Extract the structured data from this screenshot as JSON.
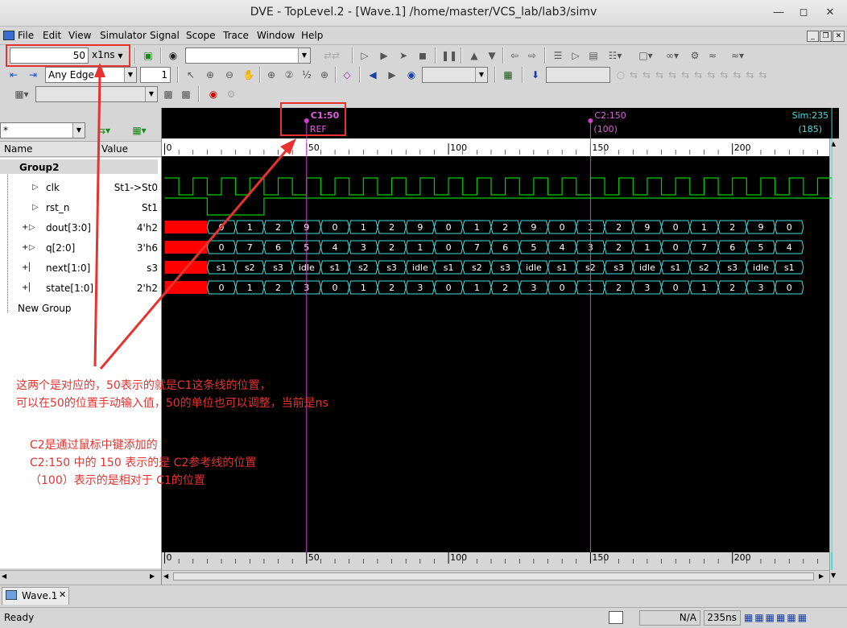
{
  "window": {
    "title": "DVE - TopLevel.2 - [Wave.1]  /home/master/VCS_lab/lab3/simv"
  },
  "menu": [
    "File",
    "Edit",
    "View",
    "Simulator",
    "Signal",
    "Scope",
    "Trace",
    "Window",
    "Help"
  ],
  "toolbar": {
    "time_value": "50",
    "time_unit": "x1ns",
    "edge_type": "Any Edge",
    "edge_count": "1"
  },
  "signal_panel": {
    "filter_value": "*",
    "col_name": "Name",
    "col_value": "Value",
    "group_name": "Group2",
    "new_group": "New Group",
    "signals": [
      {
        "name": "clk",
        "value": "St1->St0",
        "expandable": false
      },
      {
        "name": "rst_n",
        "value": "St1",
        "expandable": false
      },
      {
        "name": "dout[3:0]",
        "value": "4'h2",
        "expandable": true
      },
      {
        "name": "q[2:0]",
        "value": "3'h6",
        "expandable": true
      },
      {
        "name": "next[1:0]",
        "value": "s3",
        "expandable": true
      },
      {
        "name": "state[1:0]",
        "value": "2'h2",
        "expandable": true
      }
    ]
  },
  "markers": {
    "c1_label": "C1:50",
    "c1_sub": "REF",
    "c2_label": "C2:150",
    "c2_sub": "(100)",
    "sim_label": "Sim:235",
    "sim_sub": "(185)"
  },
  "ruler_ticks": [
    "0",
    "50",
    "100",
    "150",
    "200"
  ],
  "waves": {
    "dout": [
      "0",
      "1",
      "2",
      "9",
      "0",
      "1",
      "2",
      "9",
      "0",
      "1",
      "2",
      "9",
      "0",
      "1",
      "2",
      "9",
      "0",
      "1",
      "2",
      "9",
      "0"
    ],
    "q": [
      "0",
      "7",
      "6",
      "5",
      "4",
      "3",
      "2",
      "1",
      "0",
      "7",
      "6",
      "5",
      "4",
      "3",
      "2",
      "1",
      "0",
      "7",
      "6",
      "5",
      "4"
    ],
    "next": [
      "s1",
      "s2",
      "s3",
      "idle",
      "s1",
      "s2",
      "s3",
      "idle",
      "s1",
      "s2",
      "s3",
      "idle",
      "s1",
      "s2",
      "s3",
      "idle",
      "s1",
      "s2",
      "s3",
      "idle",
      "s1"
    ],
    "state": [
      "0",
      "1",
      "2",
      "3",
      "0",
      "1",
      "2",
      "3",
      "0",
      "1",
      "2",
      "3",
      "0",
      "1",
      "2",
      "3",
      "0",
      "1",
      "2",
      "3",
      "0"
    ]
  },
  "annotations": {
    "line1": "这两个是对应的，50表示的就是C1这条线的位置，",
    "line2": "可以在50的位置手动输入值，50的单位也可以调整，当前是ns",
    "line3": "C2是通过鼠标中键添加的",
    "line4": "C2:150 中的 150 表示的是 C2参考线的位置",
    "line5": "（100）表示的是相对于 C1的位置"
  },
  "tabs": {
    "wave_tab": "Wave.1"
  },
  "status": {
    "ready": "Ready",
    "na": "N/A",
    "time": "235ns"
  },
  "colors": {
    "wave_green": "#00d000",
    "bus_cyan": "#40e0e0",
    "cursor_magenta": "#d040d0",
    "annot_red": "#e8322f"
  }
}
